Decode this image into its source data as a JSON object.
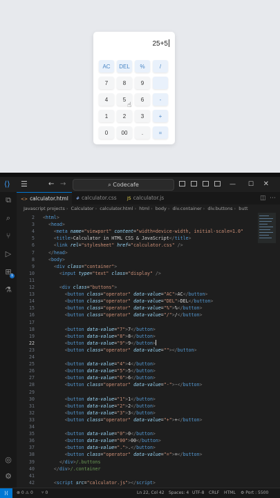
{
  "calculator": {
    "display": "25+5",
    "keys": [
      "AC",
      "DEL",
      "%",
      "/",
      "7",
      "8",
      "9",
      "",
      "4",
      "5",
      "6",
      "-",
      "1",
      "2",
      "3",
      "+",
      "0",
      "00",
      ".",
      "="
    ],
    "operator_keys": [
      "AC",
      "DEL",
      "%",
      "/",
      "-",
      "+",
      "="
    ],
    "colors": {
      "operator_bg": "#e9f1fb",
      "operator_text": "#4a86c5",
      "key_bg": "#f4f5f6"
    }
  },
  "window": {
    "search": "Codecafe",
    "icons": [
      "vscode-logo-icon",
      "menu-icon",
      "back-arrow-icon",
      "forward-arrow-icon",
      "search-icon",
      "layout-icon",
      "minimize-icon",
      "maximize-icon",
      "close-icon"
    ]
  },
  "tabs": [
    {
      "label": "calculator.html",
      "ext": "<>",
      "active": true
    },
    {
      "label": "calculator.css",
      "ext": "#",
      "active": false
    },
    {
      "label": "calculator.js",
      "ext": "JS",
      "active": false
    }
  ],
  "breadcrumb": [
    "Javascript projects",
    "Calculator",
    "calculator.html",
    "html",
    "body",
    "div.container",
    "div.buttons",
    "butt"
  ],
  "code_lines": [
    {
      "n": "2",
      "html": "<span class='c1'>&lt;</span><span class='c2'>html</span><span class='c1'>&gt;</span>"
    },
    {
      "n": "3",
      "html": "  <span class='c1'>&lt;</span><span class='c2'>head</span><span class='c1'>&gt;</span>"
    },
    {
      "n": "4",
      "html": "    <span class='c1'>&lt;</span><span class='c2'>meta</span> <span class='c3'>name</span>=<span class='c4'>\"viewport\"</span> <span class='c3'>content</span>=<span class='c4'>\"width=device-width, initial-scale=1.0\"</span>"
    },
    {
      "n": "5",
      "html": "    <span class='c1'>&lt;</span><span class='c2'>title</span><span class='c1'>&gt;</span>Calculator in HTML CSS &amp; JavaScript<span class='c1'>&lt;/</span><span class='c2'>title</span><span class='c1'>&gt;</span>"
    },
    {
      "n": "6",
      "html": "    <span class='c1'>&lt;</span><span class='c2'>link</span> <span class='c3'>rel</span>=<span class='c4'>\"stylesheet\"</span> <span class='c3'>href</span>=<span class='c4'>\"calculator.css\"</span> <span class='c1'>/&gt;</span>"
    },
    {
      "n": "7",
      "html": "  <span class='c1'>&lt;/</span><span class='c2'>head</span><span class='c1'>&gt;</span>"
    },
    {
      "n": "8",
      "html": "  <span class='c1'>&lt;</span><span class='c2'>body</span><span class='c1'>&gt;</span>"
    },
    {
      "n": "9",
      "html": "    <span class='c1'>&lt;</span><span class='c2'>div</span> <span class='c3'>class</span>=<span class='c4'>\"container\"</span><span class='c1'>&gt;</span>"
    },
    {
      "n": "10",
      "html": "      <span class='c1'>&lt;</span><span class='c2'>input</span> <span class='c3'>type</span>=<span class='c4'>\"text\"</span> <span class='c3'>class</span>=<span class='c4'>\"display\"</span> <span class='c1'>/&gt;</span>"
    },
    {
      "n": "11",
      "html": ""
    },
    {
      "n": "12",
      "html": "      <span class='c1'>&lt;</span><span class='c2'>div</span> <span class='c3'>class</span>=<span class='c4'>\"buttons\"</span><span class='c1'>&gt;</span>"
    },
    {
      "n": "13",
      "html": "        <span class='c1'>&lt;</span><span class='c2'>button</span> <span class='c3'>class</span>=<span class='c4'>\"operator\"</span> <span class='c3'>data-value</span>=<span class='c4'>\"AC\"</span><span class='c1'>&gt;</span>AC<span class='c1'>&lt;/</span><span class='c2'>button</span><span class='c1'>&gt;</span>"
    },
    {
      "n": "14",
      "html": "        <span class='c1'>&lt;</span><span class='c2'>button</span> <span class='c3'>class</span>=<span class='c4'>\"operator\"</span> <span class='c3'>data-value</span>=<span class='c4'>\"DEL\"</span><span class='c1'>&gt;</span>DEL<span class='c1'>&lt;/</span><span class='c2'>button</span><span class='c1'>&gt;</span>"
    },
    {
      "n": "15",
      "html": "        <span class='c1'>&lt;</span><span class='c2'>button</span> <span class='c3'>class</span>=<span class='c4'>\"operator\"</span> <span class='c3'>data-value</span>=<span class='c4'>\"%\"</span><span class='c1'>&gt;</span>%<span class='c1'>&lt;/</span><span class='c2'>button</span><span class='c1'>&gt;</span>"
    },
    {
      "n": "16",
      "html": "        <span class='c1'>&lt;</span><span class='c2'>button</span> <span class='c3'>class</span>=<span class='c4'>\"operator\"</span> <span class='c3'>data-value</span>=<span class='c4'>\"/\"</span><span class='c1'>&gt;</span>/<span class='c1'>&lt;/</span><span class='c2'>button</span><span class='c1'>&gt;</span>"
    },
    {
      "n": "17",
      "html": ""
    },
    {
      "n": "18",
      "html": "        <span class='c1'>&lt;</span><span class='c2'>button</span> <span class='c3'>data-value</span>=<span class='c4'>\"7\"</span><span class='c1'>&gt;</span>7<span class='c1'>&lt;/</span><span class='c2'>button</span><span class='c1'>&gt;</span>"
    },
    {
      "n": "19",
      "html": "        <span class='c1'>&lt;</span><span class='c2'>button</span> <span class='c3'>data-value</span>=<span class='c4'>\"8\"</span><span class='c1'>&gt;</span>8<span class='c1'>&lt;/</span><span class='c2'>button</span><span class='c1'>&gt;</span>"
    },
    {
      "n": "22",
      "html": "        <span class='c1'>&lt;</span><span class='c2'>button</span> <span class='c3'>data-value</span>=<span class='c4'>\"9\"</span><span class='c1'>&gt;</span>9<span class='c1'>&lt;/</span><span class='c2'>button</span><span class='c1'>&gt;</span><span class='caret-line'></span>",
      "cur": true
    },
    {
      "n": "23",
      "html": "        <span class='c1'>&lt;</span><span class='c2'>button</span> <span class='c3'>class</span>=<span class='c4'>\"operator\"</span> <span class='c3'>data-value</span>=<span class='c4'>\"\"</span><span class='c1'>&gt;&lt;/</span><span class='c2'>button</span><span class='c1'>&gt;</span>"
    },
    {
      "n": "24",
      "html": ""
    },
    {
      "n": "25",
      "html": "        <span class='c1'>&lt;</span><span class='c2'>button</span> <span class='c3'>data-value</span>=<span class='c4'>\"4\"</span><span class='c1'>&gt;</span>4<span class='c1'>&lt;/</span><span class='c2'>button</span><span class='c1'>&gt;</span>"
    },
    {
      "n": "26",
      "html": "        <span class='c1'>&lt;</span><span class='c2'>button</span> <span class='c3'>data-value</span>=<span class='c4'>\"5\"</span><span class='c1'>&gt;</span>5<span class='c1'>&lt;/</span><span class='c2'>button</span><span class='c1'>&gt;</span>"
    },
    {
      "n": "27",
      "html": "        <span class='c1'>&lt;</span><span class='c2'>button</span> <span class='c3'>data-value</span>=<span class='c4'>\"6\"</span><span class='c1'>&gt;</span>6<span class='c1'>&lt;/</span><span class='c2'>button</span><span class='c1'>&gt;</span>"
    },
    {
      "n": "28",
      "html": "        <span class='c1'>&lt;</span><span class='c2'>button</span> <span class='c3'>class</span>=<span class='c4'>\"operator\"</span> <span class='c3'>data-value</span>=<span class='c4'>\"-\"</span><span class='c1'>&gt;</span>-<span class='c1'>&lt;/</span><span class='c2'>button</span><span class='c1'>&gt;</span>"
    },
    {
      "n": "29",
      "html": ""
    },
    {
      "n": "30",
      "html": "        <span class='c1'>&lt;</span><span class='c2'>button</span> <span class='c3'>data-value</span>=<span class='c4'>\"1\"</span><span class='c1'>&gt;</span>1<span class='c1'>&lt;/</span><span class='c2'>button</span><span class='c1'>&gt;</span>"
    },
    {
      "n": "31",
      "html": "        <span class='c1'>&lt;</span><span class='c2'>button</span> <span class='c3'>data-value</span>=<span class='c4'>\"2\"</span><span class='c1'>&gt;</span>2<span class='c1'>&lt;/</span><span class='c2'>button</span><span class='c1'>&gt;</span>"
    },
    {
      "n": "32",
      "html": "        <span class='c1'>&lt;</span><span class='c2'>button</span> <span class='c3'>data-value</span>=<span class='c4'>\"3\"</span><span class='c1'>&gt;</span>3<span class='c1'>&lt;/</span><span class='c2'>button</span><span class='c1'>&gt;</span>"
    },
    {
      "n": "33",
      "html": "        <span class='c1'>&lt;</span><span class='c2'>button</span> <span class='c3'>class</span>=<span class='c4'>\"operator\"</span> <span class='c3'>data-value</span>=<span class='c4'>\"+\"</span><span class='c1'>&gt;</span>+<span class='c1'>&lt;/</span><span class='c2'>button</span><span class='c1'>&gt;</span>"
    },
    {
      "n": "34",
      "html": ""
    },
    {
      "n": "35",
      "html": "        <span class='c1'>&lt;</span><span class='c2'>button</span> <span class='c3'>data-value</span>=<span class='c4'>\"0\"</span><span class='c1'>&gt;</span>0<span class='c1'>&lt;/</span><span class='c2'>button</span><span class='c1'>&gt;</span>"
    },
    {
      "n": "36",
      "html": "        <span class='c1'>&lt;</span><span class='c2'>button</span> <span class='c3'>data-value</span>=<span class='c4'>\"00\"</span><span class='c1'>&gt;</span>00<span class='c1'>&lt;/</span><span class='c2'>button</span><span class='c1'>&gt;</span>"
    },
    {
      "n": "37",
      "html": "        <span class='c1'>&lt;</span><span class='c2'>button</span> <span class='c3'>data-value</span>=<span class='c4'>\".\"</span><span class='c1'>&gt;</span>.<span class='c1'>&lt;/</span><span class='c2'>button</span><span class='c1'>&gt;</span>"
    },
    {
      "n": "38",
      "html": "        <span class='c1'>&lt;</span><span class='c2'>button</span> <span class='c3'>class</span>=<span class='c4'>\"operator\"</span> <span class='c3'>data-value</span>=<span class='c4'>\"=\"</span><span class='c1'>&gt;</span>=<span class='c1'>&lt;/</span><span class='c2'>button</span><span class='c1'>&gt;</span>"
    },
    {
      "n": "39",
      "html": "      <span class='c1'>&lt;/</span><span class='c2'>div</span><span class='c1'>&gt;</span><span class='c6'>/.buttons</span>"
    },
    {
      "n": "40",
      "html": "    <span class='c1'>&lt;/</span><span class='c2'>div</span><span class='c1'>&gt;</span><span class='c6'>/.container</span>"
    },
    {
      "n": "41",
      "html": ""
    },
    {
      "n": "42",
      "html": "    <span class='c1'>&lt;</span><span class='c2'>script</span> <span class='c3'>src</span>=<span class='c4'>\"calculator.js\"</span><span class='c1'>&gt;&lt;/</span><span class='c2'>script</span><span class='c1'>&gt;</span>"
    }
  ],
  "statusbar": {
    "left": [
      "⊗ 0 ⚠ 0",
      "⑂ 0"
    ],
    "right": [
      "Ln 22, Col 42",
      "Spaces: 4",
      "UTF-8",
      "CRLF",
      "HTML",
      "⚙ Port : 5500"
    ]
  }
}
